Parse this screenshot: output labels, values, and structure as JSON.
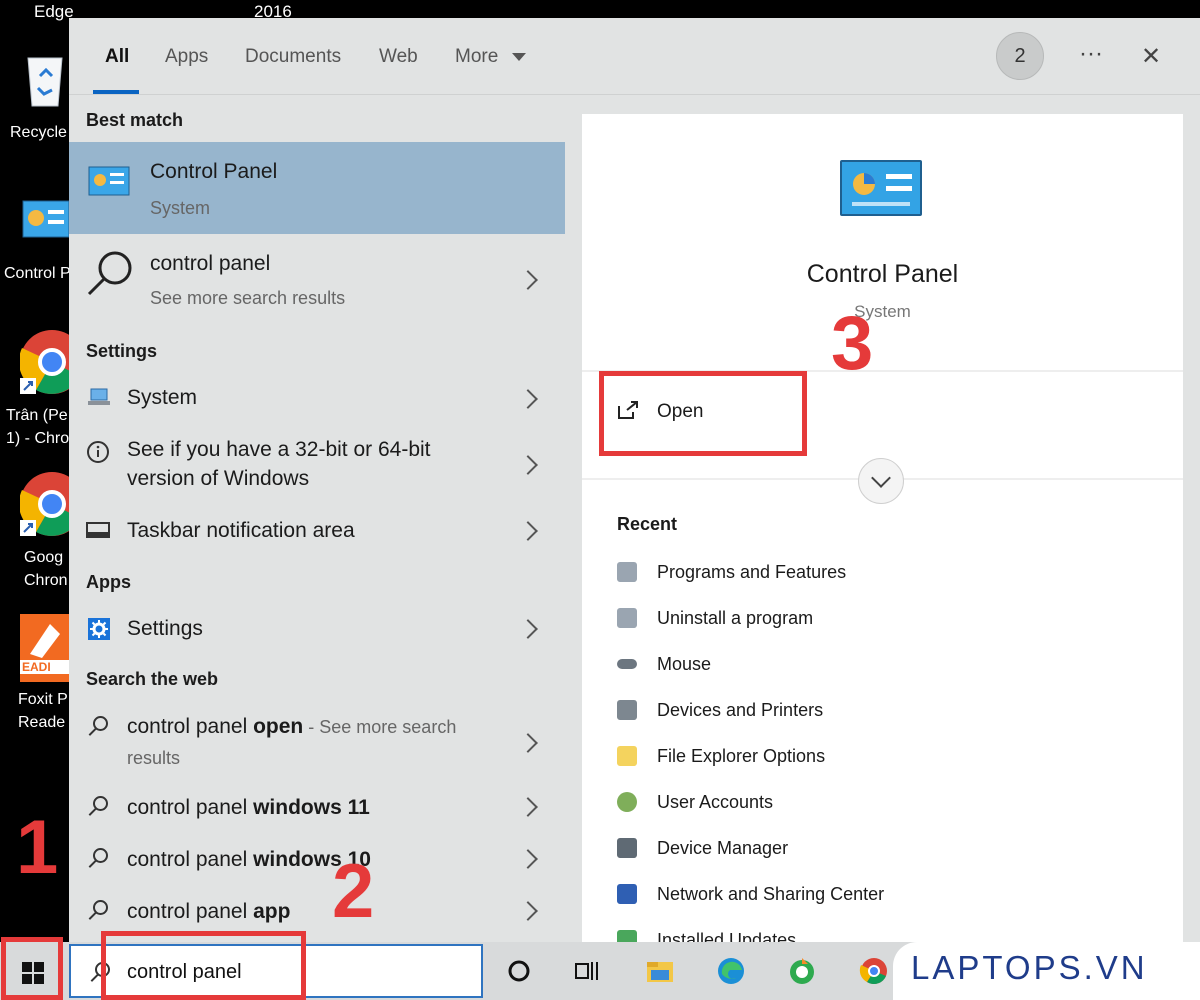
{
  "desktop": {
    "top_left": "Edge",
    "top_mid": "2016",
    "icons": [
      {
        "label": "Recycle",
        "icon": "recycle-bin-icon"
      },
      {
        "label": "Control P",
        "icon": "control-panel-icon"
      },
      {
        "label": "Trân (Pe\n1) - Chro",
        "icon": "chrome-icon"
      },
      {
        "label": "Goog\nChron",
        "icon": "chrome-icon"
      },
      {
        "label": "Foxit P\nReade",
        "icon": "foxit-reader-icon"
      }
    ]
  },
  "search_panel": {
    "tabs": [
      "All",
      "Apps",
      "Documents",
      "Web",
      "More"
    ],
    "badge": "2",
    "more_options": "···",
    "close": "✕",
    "best_match": {
      "header": "Best match",
      "title": "Control Panel",
      "subtitle": "System"
    },
    "search_more": {
      "title": "control panel",
      "subtitle": "See more search results"
    },
    "settings": {
      "header": "Settings",
      "items": [
        "System",
        "See if you have a 32-bit or 64-bit",
        "version of Windows",
        "Taskbar notification area"
      ]
    },
    "apps": {
      "header": "Apps",
      "items": [
        "Settings"
      ]
    },
    "web": {
      "header": "Search the web",
      "items": [
        {
          "prefix": "control panel ",
          "bold": "open",
          "suffix": " - See more search",
          "line2": "results"
        },
        {
          "prefix": "control panel ",
          "bold": "windows 11",
          "suffix": ""
        },
        {
          "prefix": "control panel ",
          "bold": "windows 10",
          "suffix": ""
        },
        {
          "prefix": "control panel ",
          "bold": "app",
          "suffix": ""
        }
      ]
    },
    "details": {
      "title": "Control Panel",
      "subtitle": "System",
      "open_label": "Open",
      "recent_header": "Recent",
      "recent": [
        "Programs and Features",
        "Uninstall a program",
        "Mouse",
        "Devices and Printers",
        "File Explorer Options",
        "User Accounts",
        "Device Manager",
        "Network and Sharing Center",
        "Installed Updates"
      ]
    }
  },
  "taskbar": {
    "search_value": "control panel",
    "brand": "LAPTOPS.VN"
  },
  "annotations": {
    "step1": "1",
    "step2": "2",
    "step3": "3"
  },
  "colors": {
    "highlight": "#97b5cd",
    "accent": "#0a64c2",
    "annotation": "#e53a3a"
  }
}
